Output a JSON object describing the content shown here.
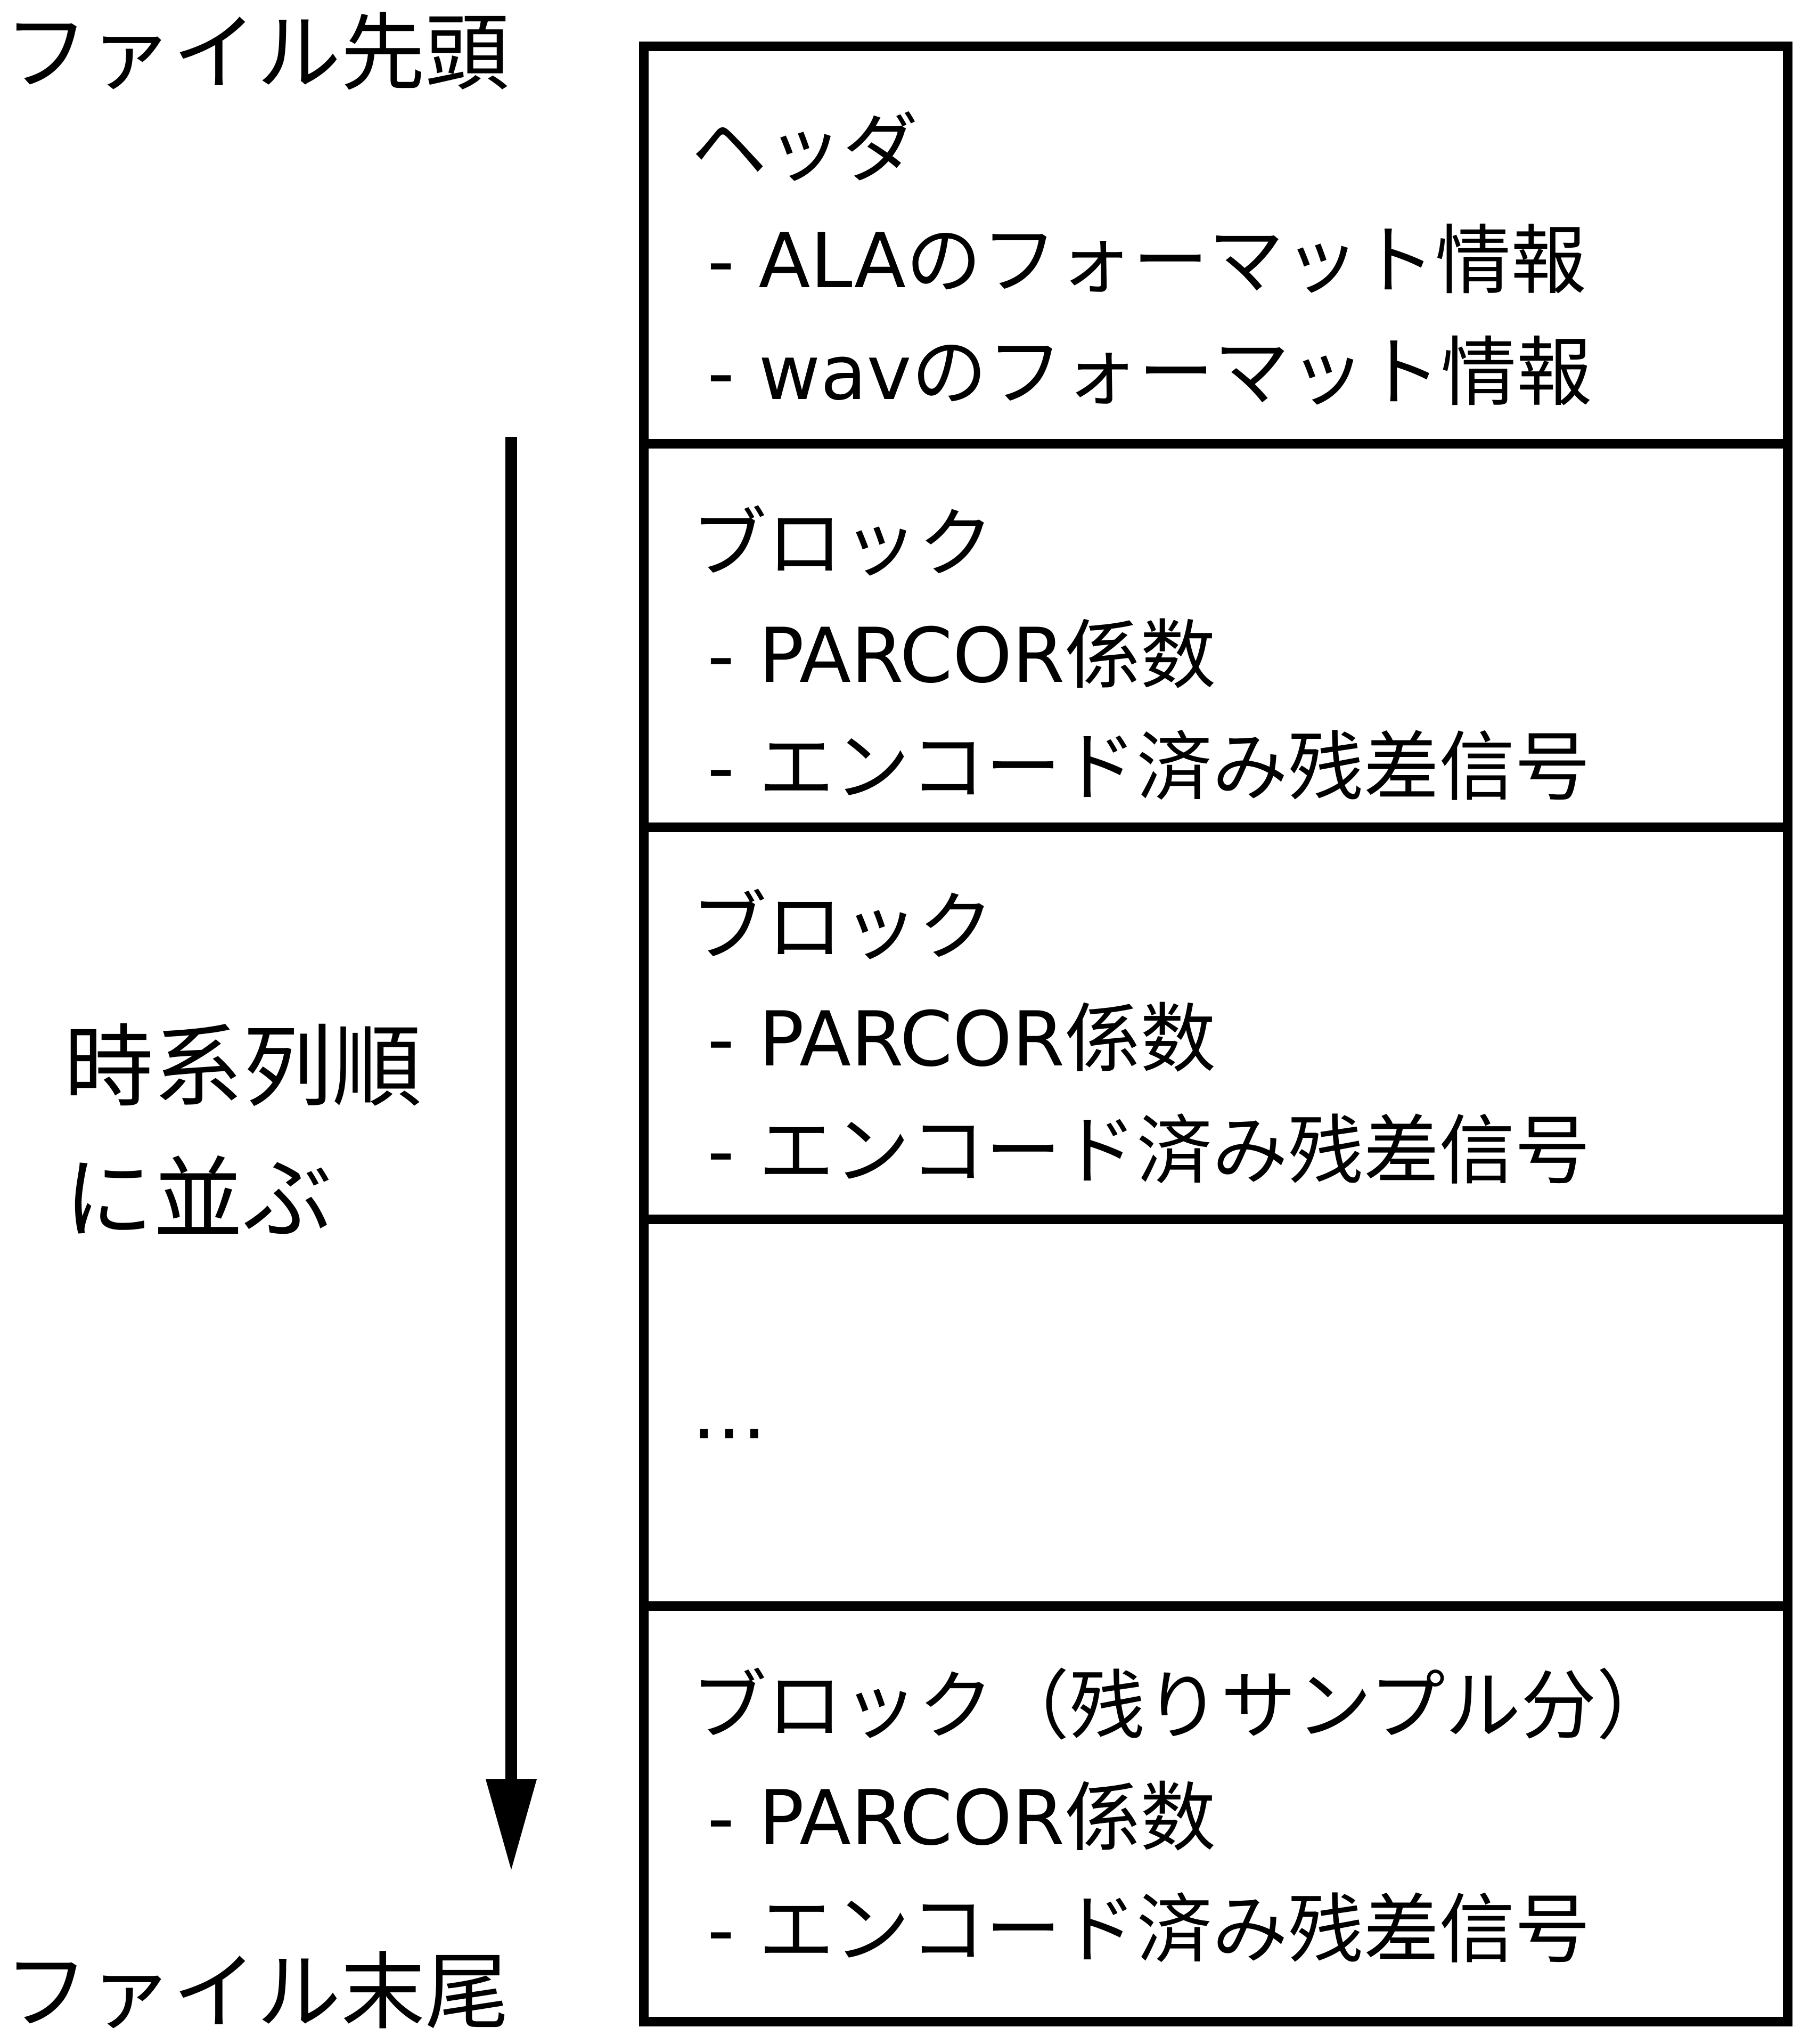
{
  "labels": {
    "file_start": "ファイル先頭",
    "file_end": "ファイル末尾",
    "time_order_line1": "時系列順",
    "time_order_line2": "に並ぶ"
  },
  "header_block": {
    "title": "ヘッダ",
    "items": [
      "- ALAのフォーマット情報",
      "- wavのフォーマット情報"
    ]
  },
  "blocks": [
    {
      "title": "ブロック",
      "items": [
        "- PARCOR係数",
        "- エンコード済み残差信号"
      ]
    },
    {
      "title": "ブロック",
      "items": [
        "- PARCOR係数",
        "- エンコード済み残差信号"
      ]
    }
  ],
  "ellipsis": "…",
  "last_block": {
    "title": "ブロック（残りサンプル分）",
    "items": [
      "- PARCOR係数",
      "- エンコード済み残差信号"
    ]
  },
  "colors": {
    "line": "#000000",
    "background": "#ffffff"
  }
}
